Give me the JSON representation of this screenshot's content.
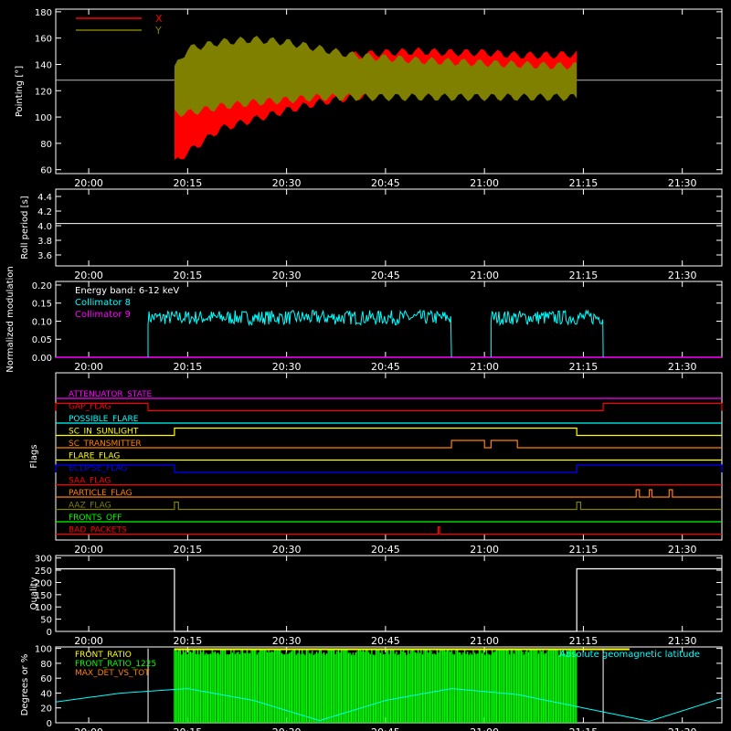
{
  "time_ticks": [
    "20:00",
    "20:15",
    "20:30",
    "20:45",
    "21:00",
    "21:15",
    "21:30"
  ],
  "time_range": [
    "19:55",
    "21:36"
  ],
  "colors": {
    "background": "#000000",
    "axes": "#ffffff",
    "x_pointing": "#ff0000",
    "y_pointing": "#808000",
    "collimator_8": "#00ffff",
    "collimator_9": "#ff00ff",
    "front_ratio": "#ffff00",
    "front_ratio_1225": "#00ff00",
    "max_det_vs_tot": "#ff8000",
    "geomagnetic_latitude": "#00ffff"
  },
  "chart_data": [
    {
      "type": "area",
      "panel": "pointing",
      "ylabel": "Pointing [°]",
      "ylim": [
        57,
        182
      ],
      "yticks": [
        60,
        80,
        100,
        120,
        140,
        160,
        180
      ],
      "reference_line": 128,
      "legend": [
        {
          "name": "X",
          "color": "#ff0000"
        },
        {
          "name": "Y",
          "color": "#808000"
        }
      ],
      "data_window": [
        "20:13",
        "21:14"
      ],
      "series": [
        {
          "name": "X",
          "x": [
            "20:13",
            "20:15",
            "20:20",
            "20:25",
            "20:30",
            "20:35",
            "20:40",
            "20:45",
            "20:50",
            "20:55",
            "21:00",
            "21:05",
            "21:10",
            "21:14"
          ],
          "upper": [
            140,
            135,
            140,
            143,
            146,
            148,
            150,
            152,
            153,
            152,
            152,
            150,
            150,
            151
          ],
          "lower": [
            62,
            70,
            88,
            95,
            102,
            108,
            112,
            115,
            117,
            118,
            118,
            118,
            120,
            122
          ]
        },
        {
          "name": "Y",
          "x": [
            "20:13",
            "20:15",
            "20:20",
            "20:25",
            "20:30",
            "20:35",
            "20:40",
            "20:45",
            "20:50",
            "20:55",
            "21:00",
            "21:05",
            "21:10",
            "21:14"
          ],
          "upper": [
            140,
            155,
            160,
            162,
            160,
            155,
            150,
            148,
            146,
            145,
            144,
            143,
            142,
            142
          ],
          "lower": [
            100,
            100,
            105,
            108,
            110,
            112,
            112,
            112,
            112,
            112,
            112,
            112,
            112,
            112
          ]
        }
      ]
    },
    {
      "type": "line",
      "panel": "roll",
      "ylabel": "Roll period [s]",
      "ylim": [
        3.45,
        4.5
      ],
      "yticks": [
        3.6,
        3.8,
        4.0,
        4.2,
        4.4
      ],
      "yticklabels": [
        "3.6",
        "3.8",
        "4.0",
        "4.2",
        "4.4"
      ],
      "series": [
        {
          "x": [
            "19:55",
            "21:36"
          ],
          "values": [
            4.03,
            4.03
          ]
        }
      ]
    },
    {
      "type": "line",
      "panel": "modulation",
      "ylabel": "Normalized modulation",
      "ylim": [
        0,
        0.21
      ],
      "yticks": [
        0,
        0.05,
        0.1,
        0.15,
        0.2
      ],
      "yticklabels": [
        "0.00",
        "0.05",
        "0.10",
        "0.15",
        "0.20"
      ],
      "annotation": "Energy band: 6-12 keV",
      "legend": [
        {
          "name": "Collimator 8",
          "color": "#00ffff"
        },
        {
          "name": "Collimator 9",
          "color": "#ff00ff"
        }
      ],
      "series": [
        {
          "name": "Collimator 8",
          "segments": [
            [
              "20:09",
              "20:55"
            ],
            [
              "21:01",
              "21:18"
            ]
          ],
          "level": 0.11,
          "noise": 0.02
        },
        {
          "name": "Collimator 9",
          "level": 0.0
        }
      ]
    },
    {
      "type": "line",
      "panel": "flags",
      "ylabel": "Flags",
      "flags": [
        {
          "name": "ATTENUATOR_STATE",
          "color": "#ff00ff",
          "on": []
        },
        {
          "name": "GAP_FLAG",
          "color": "#ff0000",
          "on": [
            [
              "19:55",
              "20:09"
            ],
            [
              "21:18",
              "21:36"
            ]
          ]
        },
        {
          "name": "POSSIBLE_FLARE",
          "color": "#00ffff",
          "on": []
        },
        {
          "name": "SC_IN_SUNLIGHT",
          "color": "#ffff00",
          "on": [
            [
              "20:13",
              "21:14"
            ]
          ]
        },
        {
          "name": "SC_TRANSMITTER",
          "color": "#ff8000",
          "on": [
            [
              "20:55",
              "21:00"
            ],
            [
              "21:01",
              "21:05"
            ]
          ]
        },
        {
          "name": "FLARE_FLAG",
          "color": "#ffff00",
          "on": []
        },
        {
          "name": "ECLIPSE_FLAG",
          "color": "#0000ff",
          "on": [
            [
              "19:55",
              "20:13"
            ],
            [
              "21:14",
              "21:36"
            ]
          ]
        },
        {
          "name": "SAA_FLAG",
          "color": "#ff0000",
          "on": []
        },
        {
          "name": "PARTICLE_FLAG",
          "color": "#ff8000",
          "on": [
            [
              "21:23",
              "21:23.5"
            ],
            [
              "21:25",
              "21:25.4"
            ],
            [
              "21:28",
              "21:28.5"
            ]
          ]
        },
        {
          "name": "AAZ_FLAG",
          "color": "#808000",
          "on": [
            [
              "20:13",
              "20:13.6"
            ],
            [
              "21:14",
              "21:14.6"
            ]
          ]
        },
        {
          "name": "FRONTS_OFF",
          "color": "#00ff00",
          "on": []
        },
        {
          "name": "BAD_PACKETS",
          "color": "#ff0000",
          "on": [
            [
              "20:53",
              "20:53.2"
            ]
          ]
        }
      ]
    },
    {
      "type": "line",
      "panel": "quality",
      "ylabel": "Quality",
      "ylim": [
        0,
        310
      ],
      "yticks": [
        0,
        50,
        100,
        150,
        200,
        250,
        300
      ],
      "series": [
        {
          "x": [
            "19:55",
            "20:13",
            "20:13",
            "21:14",
            "21:14",
            "21:36"
          ],
          "values": [
            256,
            256,
            0,
            0,
            256,
            256
          ]
        }
      ]
    },
    {
      "type": "line",
      "panel": "ratios",
      "ylabel": "Degrees or %",
      "ylim": [
        0,
        102
      ],
      "yticks": [
        0,
        20,
        40,
        60,
        80,
        100
      ],
      "legend": [
        {
          "name": "FRONT_RATIO",
          "color": "#ffff00"
        },
        {
          "name": "FRONT_RATIO_1225",
          "color": "#00ff00"
        },
        {
          "name": "MAX_DET_VS_TOT",
          "color": "#ff8000"
        }
      ],
      "right_legend": {
        "name": "Absolute geomagnetic latitude",
        "color": "#00ffff"
      },
      "series": [
        {
          "name": "Absolute geomagnetic latitude",
          "x": [
            "19:55",
            "20:05",
            "20:15",
            "20:25",
            "20:35",
            "20:45",
            "20:55",
            "21:05",
            "21:15",
            "21:25",
            "21:36"
          ],
          "values": [
            28,
            40,
            46,
            30,
            3,
            30,
            46,
            38,
            20,
            2,
            33
          ]
        },
        {
          "name": "FRONT_RATIO_1225",
          "segments": [
            [
              "20:13",
              "21:14"
            ]
          ],
          "level": 100
        }
      ]
    }
  ]
}
